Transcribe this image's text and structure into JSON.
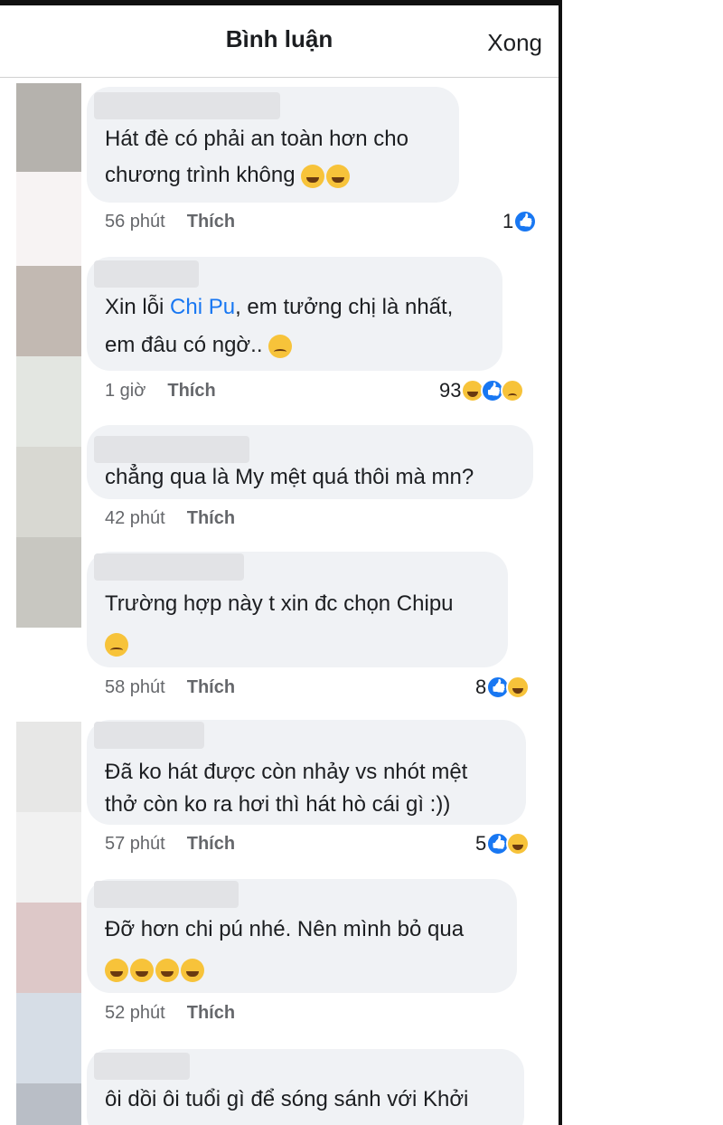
{
  "header": {
    "title": "Bình luận",
    "done_label": "Xong"
  },
  "comments": [
    {
      "line1": "Hát đè có phải an toàn hơn cho",
      "line2": "chương trình không",
      "time": "56 phút",
      "like_label": "Thích",
      "reaction_count": "1"
    },
    {
      "line1_prefix": "Xin lỗi ",
      "mention": "Chi Pu",
      "line1_suffix": ", em tưởng chị là nhất,",
      "line2": "em đâu có ngờ..",
      "time": "1 giờ",
      "like_label": "Thích",
      "reaction_count": "93"
    },
    {
      "line1": "chẳng qua là My mệt quá thôi mà mn?",
      "time": "42 phút",
      "like_label": "Thích"
    },
    {
      "line1": "Trường hợp này t xin đc chọn Chipu",
      "time": "58 phút",
      "like_label": "Thích",
      "reaction_count": "8"
    },
    {
      "line1": "Đã ko hát được còn nhảy vs nhót mệt",
      "line2": "thở còn ko ra hơi thì hát hò cái gì :))",
      "time": "57 phút",
      "like_label": "Thích",
      "reaction_count": "5"
    },
    {
      "line1": "Đỡ hơn chi pú nhé. Nên mình bỏ qua",
      "time": "52 phút",
      "like_label": "Thích"
    },
    {
      "line1": "ôi dồi ôi tuổi gì để sóng sánh với Khởi"
    }
  ],
  "colors": {
    "bubble": "#f0f2f5",
    "mention": "#1877f2",
    "meta": "#65676b",
    "like_reaction": "#1877f2",
    "emoji": "#f7c33a"
  }
}
